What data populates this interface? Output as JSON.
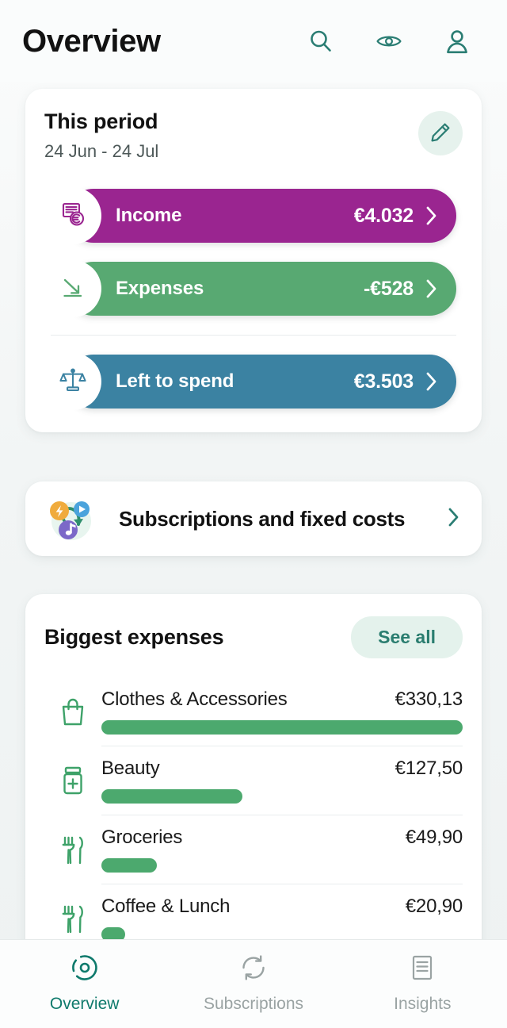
{
  "header": {
    "title": "Overview",
    "icons": [
      {
        "name": "search-icon",
        "label": "Search"
      },
      {
        "name": "eye-icon",
        "label": "Show balance"
      },
      {
        "name": "person-icon",
        "label": "Profile"
      }
    ]
  },
  "period_card": {
    "title": "This period",
    "range": "24 Jun - 24 Jul",
    "edit_icon": "pencil-icon",
    "rows": [
      {
        "icon": "money-stack-euro-icon",
        "label": "Income",
        "value": "€4.032",
        "color": "#9a2590"
      },
      {
        "icon": "trend-down-arrow-icon",
        "label": "Expenses",
        "value": "-€528",
        "color": "#58a972"
      },
      {
        "icon": "balance-scales-icon",
        "label": "Left to spend",
        "value": "€3.503",
        "color": "#3b82a2"
      }
    ]
  },
  "subscriptions_card": {
    "icon": "subscriptions-cluster-icon",
    "label": "Subscriptions and fixed costs",
    "chevron": "chevron-right-icon"
  },
  "biggest_expenses": {
    "title": "Biggest expenses",
    "see_all_label": "See all",
    "items": [
      {
        "icon": "shopping-bag-icon",
        "name": "Clothes & Accessories",
        "amount": "€330,13",
        "bar_percent": 100
      },
      {
        "icon": "medicine-jar-icon",
        "name": "Beauty",
        "amount": "€127,50",
        "bar_percent": 39
      },
      {
        "icon": "fork-knife-icon",
        "name": "Groceries",
        "amount": "€49,90",
        "bar_percent": 15.4
      },
      {
        "icon": "fork-knife-icon",
        "name": "Coffee & Lunch",
        "amount": "€20,90",
        "bar_percent": 6.5
      }
    ]
  },
  "bottom_nav": {
    "items": [
      {
        "icon": "overview-target-icon",
        "label": "Overview",
        "active": true
      },
      {
        "icon": "refresh-cycle-icon",
        "label": "Subscriptions",
        "active": false
      },
      {
        "icon": "document-lines-icon",
        "label": "Insights",
        "active": false
      }
    ]
  },
  "colors": {
    "teal": "#2a7d73",
    "purple": "#9a2590",
    "green": "#58a972",
    "blue": "#3b82a2",
    "bar_green": "#4ca96e",
    "mint": "#e4f2ec",
    "gray": "#9aa3a3"
  }
}
